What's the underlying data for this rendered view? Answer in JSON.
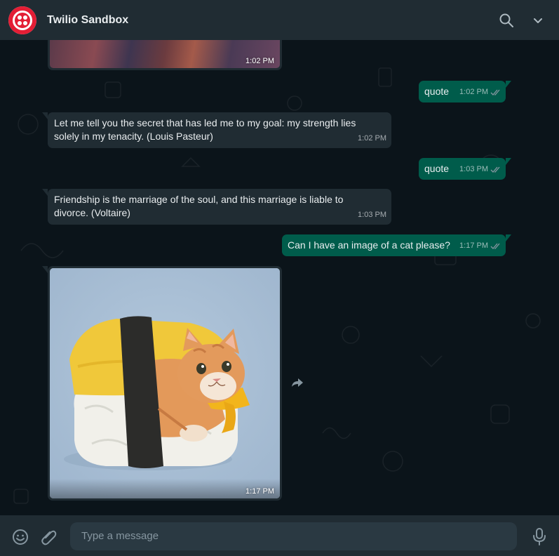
{
  "header": {
    "title": "Twilio Sandbox",
    "avatar_icon": "twilio-logo-icon",
    "brand_color": "#e31e35"
  },
  "messages": [
    {
      "type": "image",
      "direction": "in",
      "time": "1:02 PM"
    },
    {
      "type": "text",
      "direction": "out",
      "text": "quote",
      "time": "1:02 PM"
    },
    {
      "type": "text",
      "direction": "in",
      "text": "Let me tell you the secret that has led me to my goal: my strength lies solely in my tenacity. (Louis Pasteur)",
      "time": "1:02 PM"
    },
    {
      "type": "text",
      "direction": "out",
      "text": "quote",
      "time": "1:03 PM"
    },
    {
      "type": "text",
      "direction": "in",
      "text": "Friendship is the marriage of the soul, and this marriage is liable to divorce. (Voltaire)",
      "time": "1:03 PM"
    },
    {
      "type": "text",
      "direction": "out",
      "text": "Can I have an image of a cat please?",
      "time": "1:17 PM"
    },
    {
      "type": "image",
      "direction": "in",
      "alt": "cat-sushi",
      "time": "1:17 PM"
    }
  ],
  "composer": {
    "placeholder": "Type a message"
  },
  "colors": {
    "outgoing": "#005c4b",
    "incoming": "#202c33",
    "background": "#0b141a",
    "ticks": "#8696a0"
  }
}
